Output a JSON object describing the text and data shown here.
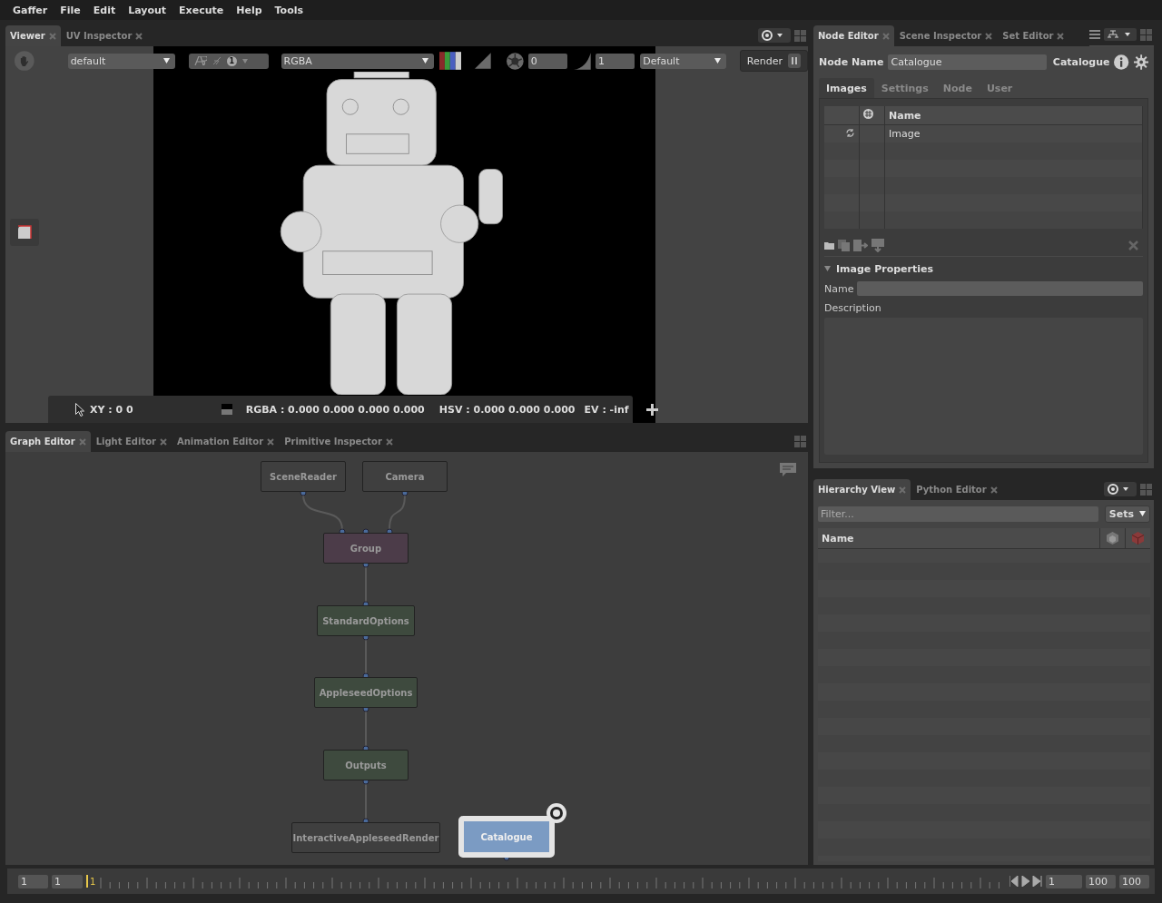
{
  "menu": [
    "Gaffer",
    "File",
    "Edit",
    "Layout",
    "Execute",
    "Help",
    "Tools"
  ],
  "viewer": {
    "tabs": [
      {
        "label": "Viewer",
        "selected": true
      },
      {
        "label": "UV Inspector",
        "selected": false
      }
    ],
    "layer": "default",
    "compare_badge": "1",
    "channels": "RGBA",
    "exposure": "0",
    "gamma": "1",
    "display_transform": "Default",
    "render_button": "Render",
    "status": {
      "xy": "XY : 0 0",
      "rgba": "RGBA : 0.000 0.000 0.000 0.000",
      "hsv": "HSV : 0.000 0.000 0.000",
      "ev": "EV : -inf"
    }
  },
  "graph_editor": {
    "tabs": [
      {
        "label": "Graph Editor",
        "selected": true
      },
      {
        "label": "Light Editor",
        "selected": false
      },
      {
        "label": "Animation Editor",
        "selected": false
      },
      {
        "label": "Primitive Inspector",
        "selected": false
      }
    ],
    "nodes": [
      {
        "label": "SceneReader",
        "kind": "source",
        "color": "#3f3f3f",
        "selected": false
      },
      {
        "label": "Camera",
        "kind": "source",
        "color": "#3f3f3f",
        "selected": false
      },
      {
        "label": "Group",
        "kind": "group",
        "color": "#4c3c49",
        "selected": false
      },
      {
        "label": "StandardOptions",
        "kind": "filter",
        "color": "#3e4a3e",
        "selected": false
      },
      {
        "label": "AppleseedOptions",
        "kind": "filter",
        "color": "#3e4a3e",
        "selected": false
      },
      {
        "label": "Outputs",
        "kind": "filter",
        "color": "#3e4a3e",
        "selected": false
      },
      {
        "label": "InteractiveAppleseedRender",
        "kind": "sink",
        "color": "#3f3f3f",
        "selected": false
      },
      {
        "label": "Catalogue",
        "kind": "source",
        "color": "#7b9bc3",
        "selected": true
      }
    ]
  },
  "node_editor": {
    "tabs": [
      {
        "label": "Node Editor",
        "selected": true
      },
      {
        "label": "Scene Inspector",
        "selected": false
      },
      {
        "label": "Set Editor",
        "selected": false
      }
    ],
    "node_name_label": "Node Name",
    "node_name": "Catalogue",
    "node_type": "Catalogue",
    "section_tabs": [
      {
        "label": "Images",
        "selected": true
      },
      {
        "label": "Settings",
        "selected": false
      },
      {
        "label": "Node",
        "selected": false
      },
      {
        "label": "User",
        "selected": false
      }
    ],
    "images": {
      "columns": [
        "Name"
      ],
      "rows": [
        {
          "name": "Image"
        }
      ]
    },
    "image_properties": {
      "title": "Image Properties",
      "expanded": true,
      "name_label": "Name",
      "description_label": "Description"
    }
  },
  "hierarchy_view": {
    "tabs": [
      {
        "label": "Hierarchy View",
        "selected": true
      },
      {
        "label": "Python Editor",
        "selected": false
      }
    ],
    "filter_placeholder": "Filter...",
    "sets_button": "Sets",
    "columns": [
      "Name"
    ]
  },
  "timeline": {
    "start": "1",
    "playback_start": "1",
    "current_frame": "1",
    "frame": "1",
    "playback_end": "100",
    "end": "100"
  }
}
